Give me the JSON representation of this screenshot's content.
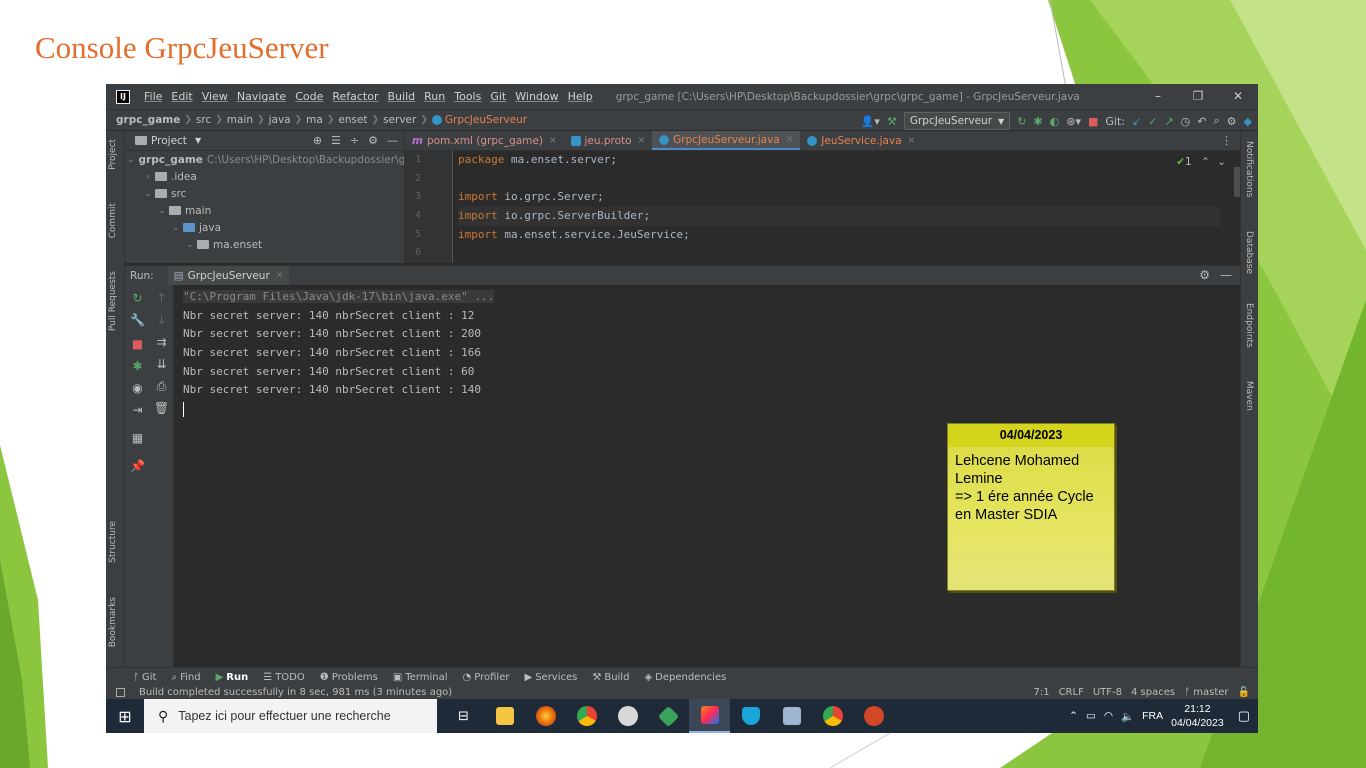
{
  "slide": {
    "title": "Console GrpcJeuServer"
  },
  "titlebar": {
    "menu": [
      "File",
      "Edit",
      "View",
      "Navigate",
      "Code",
      "Refactor",
      "Build",
      "Run",
      "Tools",
      "Git",
      "Window",
      "Help"
    ],
    "window_title": "grpc_game [C:\\Users\\HP\\Desktop\\Backupdossier\\grpc\\grpc_game] - GrpcJeuServeur.java",
    "controls": [
      "–",
      "❐",
      "✕"
    ]
  },
  "breadcrumb": [
    "grpc_game",
    "src",
    "main",
    "java",
    "ma",
    "enset",
    "server",
    "GrpcJeuServeur"
  ],
  "toolbar": {
    "run_config": "GrpcJeuServeur",
    "git_label": "Git:"
  },
  "side_tabs": {
    "project": "Project",
    "commit": "Commit",
    "pull_requests": "Pull Requests",
    "structure": "Structure",
    "bookmarks": "Bookmarks"
  },
  "right_tabs": {
    "notifications": "Notifications",
    "database": "Database",
    "endpoints": "Endpoints",
    "maven": "Maven"
  },
  "project_panel": {
    "header": "Project",
    "root": {
      "name": "grpc_game",
      "path": "C:\\Users\\HP\\Desktop\\Backupdossier\\grpc"
    },
    "items": [
      ".idea",
      "src",
      "main",
      "java",
      "ma.enset"
    ]
  },
  "editor": {
    "tabs": [
      {
        "label": "pom.xml (grpc_game)",
        "icon": "maven-icon",
        "color": "#b96fd6"
      },
      {
        "label": "jeu.proto",
        "icon": "proto-icon",
        "color": "#3592c4"
      },
      {
        "label": "GrpcJeuServeur.java",
        "icon": "class-icon",
        "color": "#3592c4"
      },
      {
        "label": "JeuService.java",
        "icon": "class-icon",
        "color": "#3592c4"
      }
    ],
    "active_tab": "GrpcJeuServeur.java",
    "line_numbers": [
      "1",
      "2",
      "3",
      "4",
      "5",
      "6"
    ],
    "lines": [
      {
        "kw": "package",
        "rest": " ma.enset.server;"
      },
      {
        "kw": "",
        "rest": ""
      },
      {
        "kw": "import",
        "rest": " io.grpc.Server;"
      },
      {
        "kw": "import",
        "rest": " io.grpc.ServerBuilder;"
      },
      {
        "kw": "import",
        "rest": " ma.enset.service.JeuService;"
      },
      {
        "kw": "",
        "rest": ""
      }
    ],
    "inspection": "1"
  },
  "run_panel": {
    "label": "Run:",
    "tab": "GrpcJeuServeur",
    "command": "\"C:\\Program Files\\Java\\jdk-17\\bin\\java.exe\" ...",
    "output": [
      "Nbr secret server: 140 nbrSecret client : 12",
      "Nbr secret server: 140 nbrSecret client : 200",
      "Nbr secret server: 140 nbrSecret client : 166",
      "Nbr secret server: 140 nbrSecret client : 60",
      "Nbr secret server: 140 nbrSecret client : 140"
    ]
  },
  "sticky_note": {
    "date": "04/04/2023",
    "lines": [
      "Lehcene Mohamed",
      "Lemine",
      "=> 1 ére année Cycle",
      "en Master SDIA"
    ]
  },
  "bottom_tabs": [
    "Git",
    "Find",
    "Run",
    "TODO",
    "Problems",
    "Terminal",
    "Profiler",
    "Services",
    "Build",
    "Dependencies"
  ],
  "status": {
    "message": "Build completed successfully in 8 sec, 981 ms (3 minutes ago)",
    "position": "7:1",
    "line_sep": "CRLF",
    "encoding": "UTF-8",
    "indent": "4 spaces",
    "branch": "master"
  },
  "taskbar": {
    "search_placeholder": "Tapez ici pour effectuer une recherche",
    "lang": "FRA",
    "time": "21:12",
    "date": "04/04/2023"
  }
}
